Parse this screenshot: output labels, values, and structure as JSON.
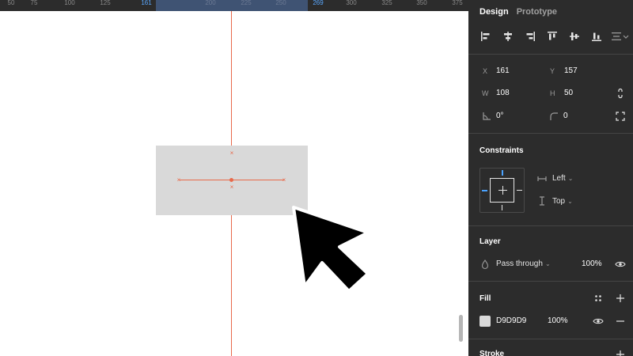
{
  "ruler": {
    "ticks": [
      "50",
      "75",
      "100",
      "125",
      "161",
      "200",
      "225",
      "250",
      "269",
      "300",
      "325",
      "350",
      "375"
    ]
  },
  "canvas": {
    "background": "#ffffff",
    "shape_fill": "#d9d9d9",
    "guide_color": "#e8694a"
  },
  "panel": {
    "tabs": {
      "design": "Design",
      "prototype": "Prototype"
    },
    "alignment": [
      "align-left-icon",
      "align-horizontal-center-icon",
      "align-right-icon",
      "align-top-icon",
      "align-vertical-center-icon",
      "align-bottom-icon",
      "distribute-icon"
    ],
    "position": {
      "x_label": "X",
      "x_value": "161",
      "y_label": "Y",
      "y_value": "157",
      "w_label": "W",
      "w_value": "108",
      "h_label": "H",
      "h_value": "50",
      "rotation_value": "0°",
      "radius_value": "0"
    },
    "constraints": {
      "title": "Constraints",
      "horizontal": "Left",
      "vertical": "Top"
    },
    "layer": {
      "title": "Layer",
      "blend": "Pass through",
      "opacity": "100%"
    },
    "fill": {
      "title": "Fill",
      "hex": "D9D9D9",
      "opacity": "100%",
      "color": "#d9d9d9"
    },
    "stroke": {
      "title": "Stroke"
    }
  }
}
